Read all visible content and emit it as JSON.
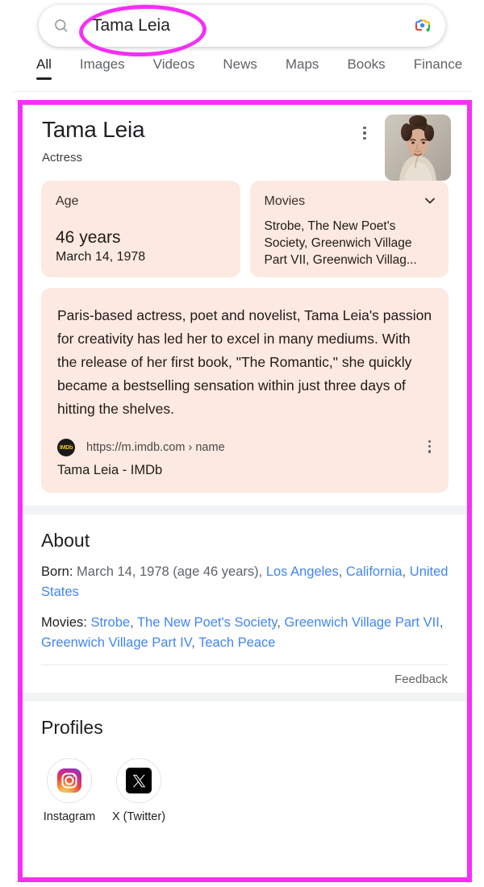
{
  "search": {
    "query": "Tama Leia",
    "placeholder": "Search",
    "search_icon": "search-icon",
    "lens_icon": "google-lens-icon"
  },
  "tabs": [
    {
      "label": "All",
      "active": true
    },
    {
      "label": "Images",
      "active": false
    },
    {
      "label": "Videos",
      "active": false
    },
    {
      "label": "News",
      "active": false
    },
    {
      "label": "Maps",
      "active": false
    },
    {
      "label": "Books",
      "active": false
    },
    {
      "label": "Finance",
      "active": false
    }
  ],
  "knowledge_panel": {
    "title": "Tama Leia",
    "subtitle": "Actress",
    "more_icon": "more-vert-icon",
    "avatar_alt": "portrait-photo",
    "cards": [
      {
        "label": "Age",
        "big": "46 years",
        "sub": "March 14, 1978",
        "has_chevron": false
      },
      {
        "label": "Movies",
        "has_chevron": true,
        "chevron_icon": "chevron-down-icon",
        "lines": [
          "Strobe, The New Poet's",
          "Society, Greenwich Village",
          "Part VII, Greenwich Villag..."
        ]
      }
    ],
    "description": "Paris-based actress, poet and novelist, Tama Leia's passion for creativity has led her to excel in many mediums. With the release of her first book, \"The Romantic,\" she quickly became a bestselling sensation within just three days of hitting the shelves.",
    "source": {
      "favicon_text": "IMDb",
      "favicon_name": "imdb-favicon",
      "url": "https://m.imdb.com › name",
      "title": "Tama Leia - IMDb",
      "more_icon": "more-vert-icon"
    }
  },
  "about": {
    "heading": "About",
    "born": {
      "label": "Born:",
      "value": " March 14, 1978 (age 46 years), ",
      "links": [
        "Los Angeles",
        "California",
        "United States"
      ]
    },
    "movies": {
      "label": "Movies:",
      "links": [
        "Strobe",
        "The New Poet's Society",
        "Greenwich Village Part VII",
        "Greenwich Village Part IV",
        "Teach Peace"
      ]
    },
    "feedback": "Feedback"
  },
  "profiles": {
    "heading": "Profiles",
    "items": [
      {
        "label": "Instagram",
        "icon": "instagram-icon"
      },
      {
        "label": "X (Twitter)",
        "icon": "x-twitter-icon"
      }
    ]
  },
  "annotation": {
    "color": "#f52ff5",
    "shapes": [
      "query-ellipse",
      "knowledge-panel-rectangle"
    ]
  }
}
